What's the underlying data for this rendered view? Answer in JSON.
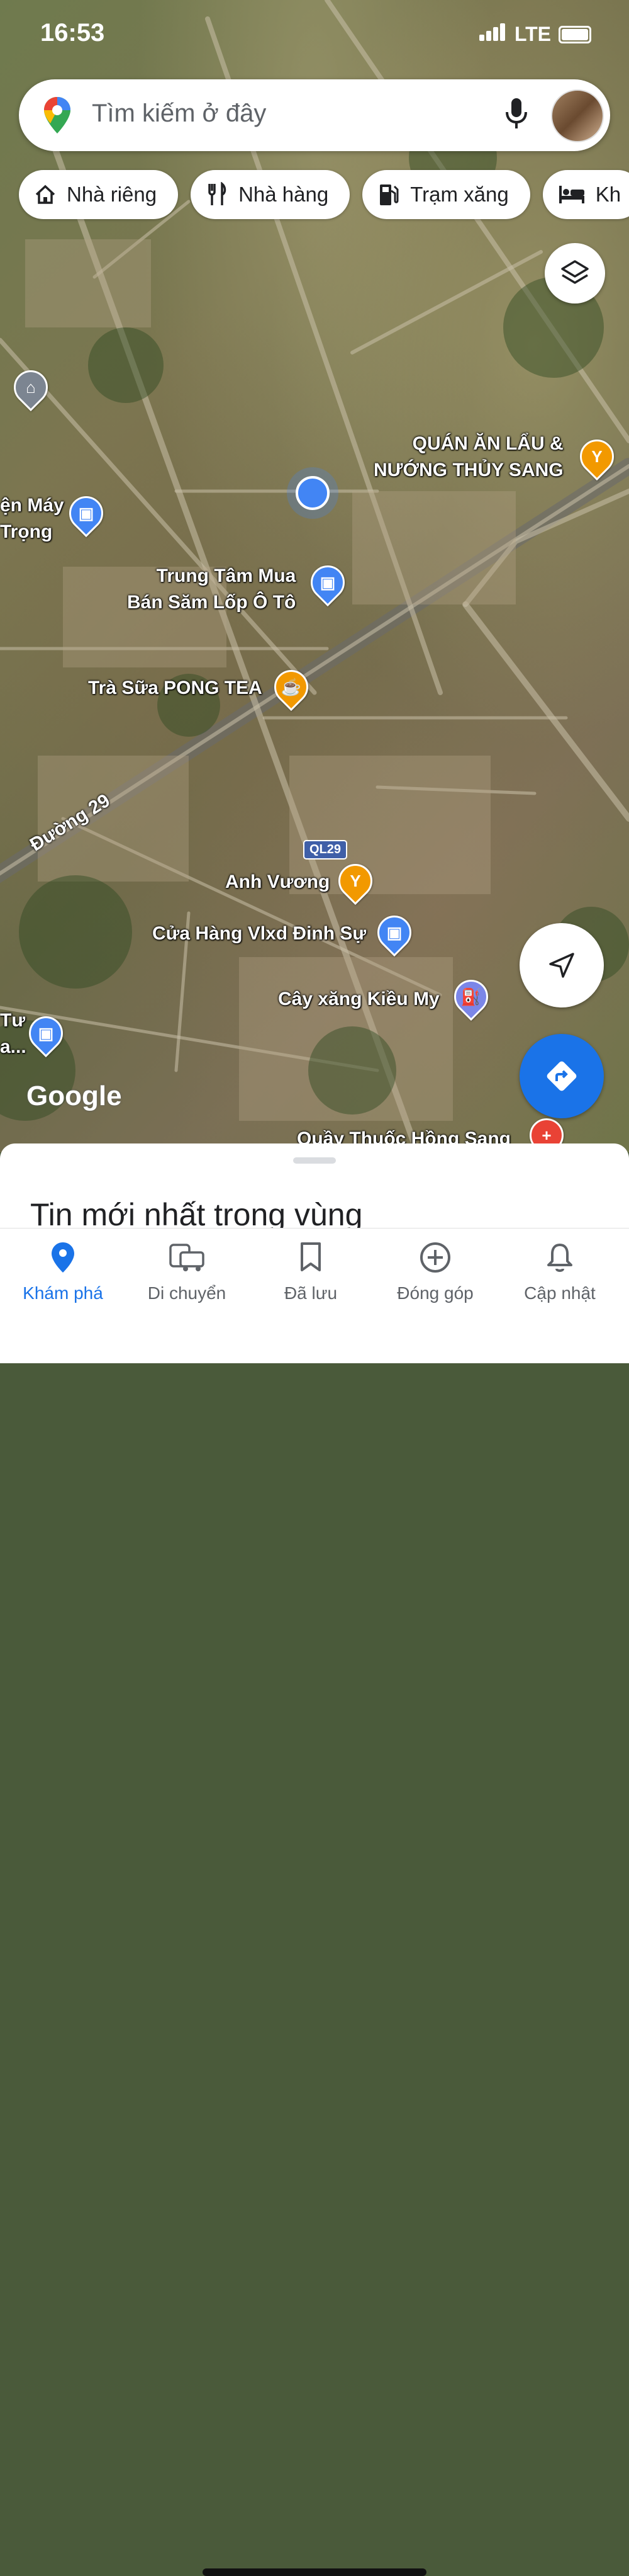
{
  "status_bar": {
    "time": "16:53",
    "network": "LTE"
  },
  "search": {
    "placeholder": "Tìm kiếm ở đây"
  },
  "chips": [
    {
      "label": "Nhà riêng",
      "icon": "home-icon"
    },
    {
      "label": "Nhà hàng",
      "icon": "restaurant-icon"
    },
    {
      "label": "Trạm xăng",
      "icon": "gas-station-icon"
    },
    {
      "label": "Kh",
      "icon": "hotel-bed-icon"
    }
  ],
  "map": {
    "pois": [
      {
        "name": "QUÁN ĂN LẨU &\nNƯỚNG THỦY SANG",
        "category": "restaurant"
      },
      {
        "name": "ện Máy\nTrọng",
        "category": "shopping"
      },
      {
        "name": "Trung Tâm Mua\nBán Săm Lốp Ô Tô",
        "category": "shopping"
      },
      {
        "name": "Trà Sữa PONG TEA",
        "category": "cafe"
      },
      {
        "name": "Anh Vương",
        "category": "restaurant"
      },
      {
        "name": "Cửa Hàng Vlxd Đinh Sự",
        "category": "shopping"
      },
      {
        "name": "Cây xăng Kiều My",
        "category": "gas-station"
      },
      {
        "name": "Tư\na...",
        "category": "shopping"
      },
      {
        "name": "Quầy Thuốc Hồng Sang",
        "category": "pharmacy"
      }
    ],
    "road_labels": {
      "duong29": "Đường 29",
      "shield": "QL29"
    },
    "attribution": "Google"
  },
  "sheet": {
    "title": "Tin mới nhất trong vùng"
  },
  "nav": [
    {
      "label": "Khám phá",
      "icon": "explore-pin-icon",
      "active": true
    },
    {
      "label": "Di chuyển",
      "icon": "commute-icon",
      "active": false
    },
    {
      "label": "Đã lưu",
      "icon": "saved-bookmark-icon",
      "active": false
    },
    {
      "label": "Đóng góp",
      "icon": "contribute-plus-icon",
      "active": false
    },
    {
      "label": "Cập nhật",
      "icon": "updates-bell-icon",
      "active": false
    }
  ],
  "colors": {
    "accent": "#1a73e8",
    "my_location": "#4285f4"
  }
}
